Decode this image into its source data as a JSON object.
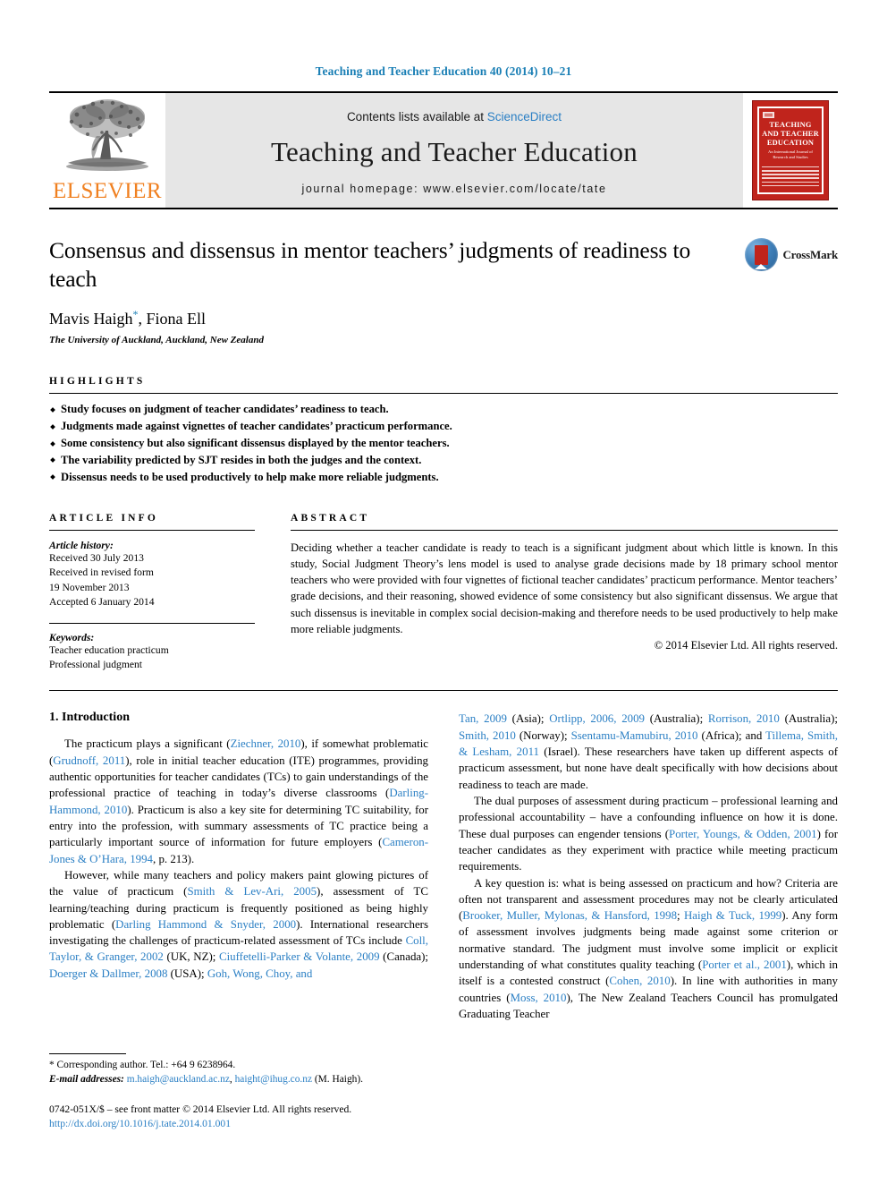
{
  "running_head": "Teaching and Teacher Education 40 (2014) 10–21",
  "banner": {
    "publisher_wordmark": "ELSEVIER",
    "contents_prefix": "Contents lists available at ",
    "contents_link": "ScienceDirect",
    "journal_title": "Teaching and Teacher Education",
    "homepage": "journal homepage: www.elsevier.com/locate/tate",
    "cover": {
      "title_line1": "TEACHING",
      "title_line2": "AND TEACHER",
      "title_line3": "EDUCATION",
      "subtitle": "An International Journal of Research and Studies"
    }
  },
  "article": {
    "title": "Consensus and dissensus in mentor teachers’ judgments of readiness to teach",
    "authors": "Mavis Haigh, Fiona Ell",
    "author_marker": "*",
    "affiliation": "The University of Auckland, Auckland, New Zealand",
    "crossmark_label": "CrossMark"
  },
  "highlights": {
    "heading": "HIGHLIGHTS",
    "items": [
      "Study focuses on judgment of teacher candidates’ readiness to teach.",
      "Judgments made against vignettes of teacher candidates’ practicum performance.",
      "Some consistency but also significant dissensus displayed by the mentor teachers.",
      "The variability predicted by SJT resides in both the judges and the context.",
      "Dissensus needs to be used productively to help make more reliable judgments."
    ]
  },
  "article_info": {
    "heading": "ARTICLE INFO",
    "history_label": "Article history:",
    "history": [
      "Received 30 July 2013",
      "Received in revised form",
      "19 November 2013",
      "Accepted 6 January 2014"
    ],
    "keywords_label": "Keywords:",
    "keywords": [
      "Teacher education practicum",
      "Professional judgment"
    ]
  },
  "abstract": {
    "heading": "ABSTRACT",
    "text": "Deciding whether a teacher candidate is ready to teach is a significant judgment about which little is known. In this study, Social Judgment Theory’s lens model is used to analyse grade decisions made by 18 primary school mentor teachers who were provided with four vignettes of fictional teacher candidates’ practicum performance. Mentor teachers’ grade decisions, and their reasoning, showed evidence of some consistency but also significant dissensus. We argue that such dissensus is inevitable in complex social decision-making and therefore needs to be used productively to help make more reliable judgments.",
    "copyright": "© 2014 Elsevier Ltd. All rights reserved."
  },
  "intro": {
    "heading": "1. Introduction",
    "left_paragraphs": [
      "The practicum plays a significant (Ziechner, 2010), if somewhat problematic (Grudnoff, 2011), role in initial teacher education (ITE) programmes, providing authentic opportunities for teacher candidates (TCs) to gain understandings of the professional practice of teaching in today’s diverse classrooms (Darling-Hammond, 2010). Practicum is also a key site for determining TC suitability, for entry into the profession, with summary assessments of TC practice being a particularly important source of information for future employers (Cameron-Jones & O’Hara, 1994, p. 213).",
      "However, while many teachers and policy makers paint glowing pictures of the value of practicum (Smith & Lev-Ari, 2005), assessment of TC learning/teaching during practicum is frequently positioned as being highly problematic (Darling Hammond & Snyder, 2000). International researchers investigating the challenges of practicum-related assessment of TCs include Coll, Taylor, & Granger, 2002 (UK, NZ); Ciuffetelli-Parker & Volante, 2009 (Canada); Doerger & Dallmer, 2008 (USA); Goh, Wong, Choy, and"
    ],
    "right_paragraphs": [
      "Tan, 2009 (Asia); Ortlipp, 2006, 2009 (Australia); Rorrison, 2010 (Australia); Smith, 2010 (Norway); Ssentamu-Mamubiru, 2010 (Africa); and Tillema, Smith, & Lesham, 2011 (Israel). These researchers have taken up different aspects of practicum assessment, but none have dealt specifically with how decisions about readiness to teach are made.",
      "The dual purposes of assessment during practicum – professional learning and professional accountability – have a confounding influence on how it is done. These dual purposes can engender tensions (Porter, Youngs, & Odden, 2001) for teacher candidates as they experiment with practice while meeting practicum requirements.",
      "A key question is: what is being assessed on practicum and how? Criteria are often not transparent and assessment procedures may not be clearly articulated (Brooker, Muller, Mylonas, & Hansford, 1998; Haigh & Tuck, 1999). Any form of assessment involves judgments being made against some criterion or normative standard. The judgment must involve some implicit or explicit understanding of what constitutes quality teaching (Porter et al., 2001), which in itself is a contested construct (Cohen, 2010). In line with authorities in many countries (Moss, 2010), The New Zealand Teachers Council has promulgated Graduating Teacher"
    ]
  },
  "footnotes": {
    "corresponding": "* Corresponding author. Tel.: +64 9 6238964.",
    "email_label": "E-mail addresses:",
    "email1": "m.haigh@auckland.ac.nz",
    "email2": "haight@ihug.co.nz",
    "email_suffix": "(M. Haigh).",
    "issn_line": "0742-051X/$ – see front matter © 2014 Elsevier Ltd. All rights reserved.",
    "doi": "http://dx.doi.org/10.1016/j.tate.2014.01.001"
  },
  "colors": {
    "link": "#2a7fc4",
    "runhead": "#1a7fb5",
    "elsevier_orange": "#f08020",
    "cover_red": "#c0241c"
  }
}
